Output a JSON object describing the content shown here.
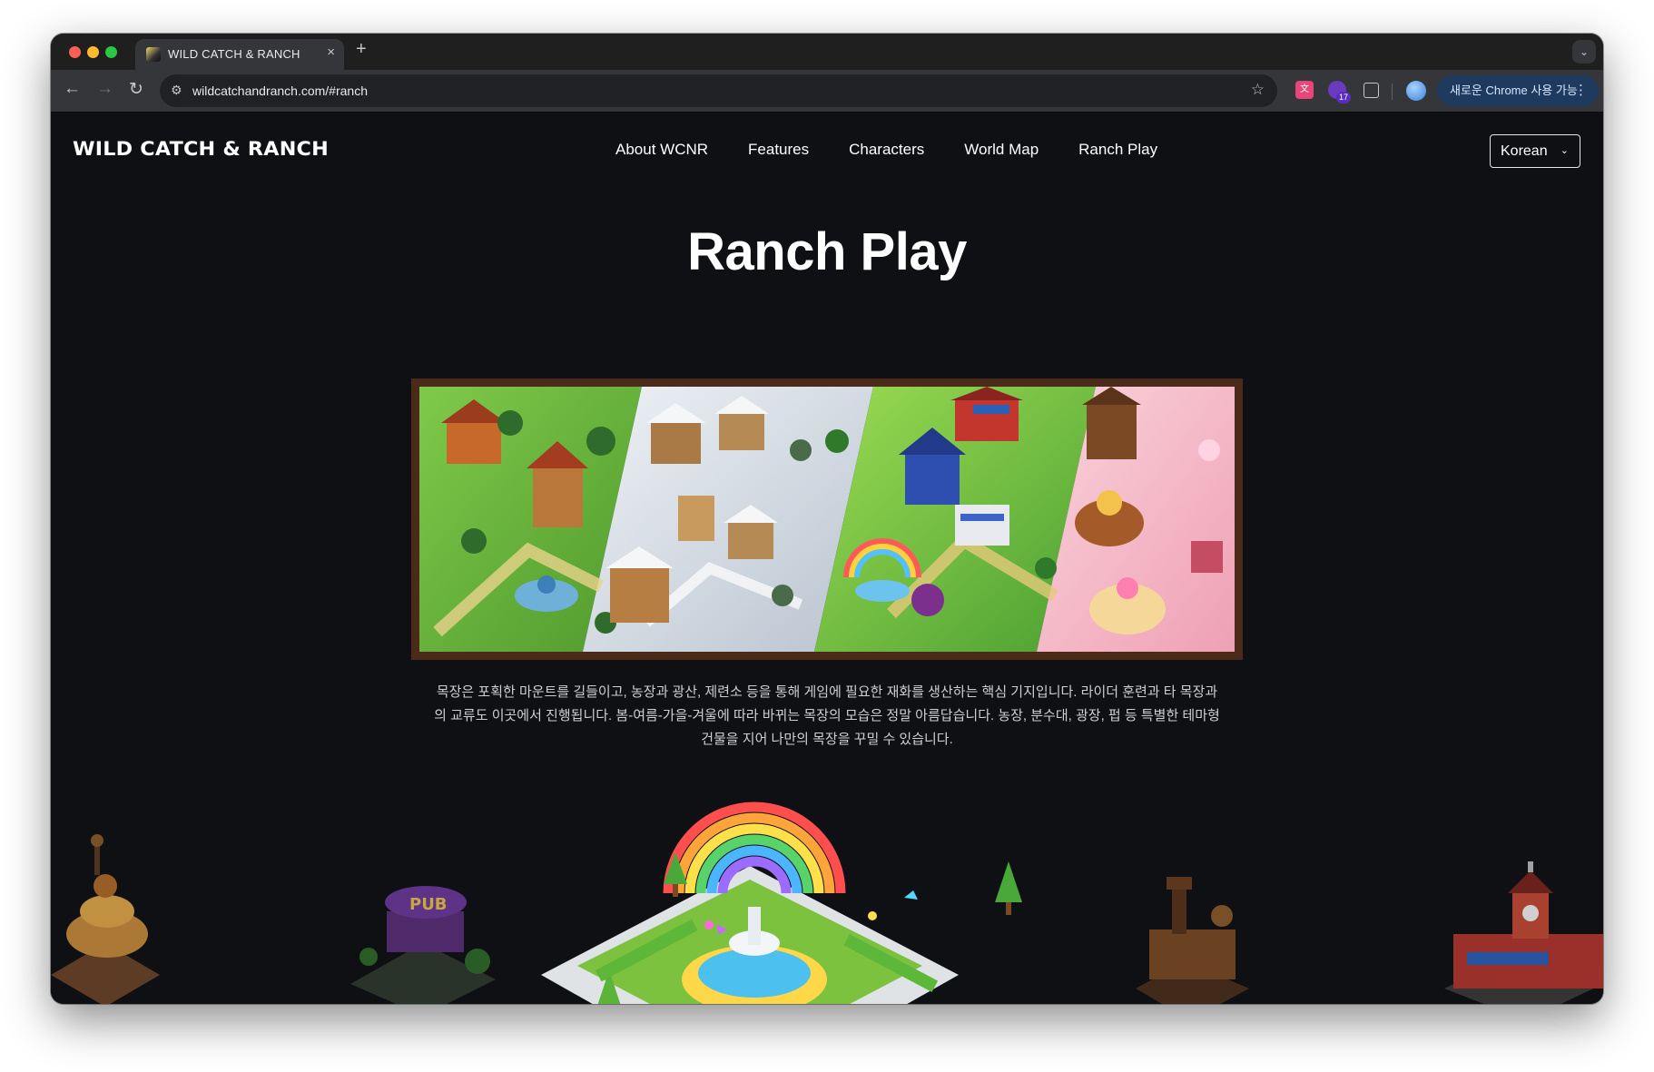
{
  "browser": {
    "tab_title": "WILD CATCH & RANCH",
    "tab_close": "×",
    "new_tab": "+",
    "tab_menu": "⌄",
    "back": "←",
    "forward": "→",
    "reload": "↻",
    "url": "wildcatchandranch.com/#ranch",
    "bookmark": "☆",
    "update_label": "새로운 Chrome 사용 가능",
    "update_menu": "⋮",
    "extension_badge": "17"
  },
  "site": {
    "logo": "WILD CATCH & RANCH",
    "nav": [
      "About WCNR",
      "Features",
      "Characters",
      "World Map",
      "Ranch Play"
    ],
    "language": "Korean",
    "language_chevron": "⌄"
  },
  "section": {
    "title": "Ranch Play",
    "description": "목장은 포획한 마운트를 길들이고, 농장과 광산, 제련소 등을 통해 게임에 필요한 재화를 생산하는 핵심 기지입니다. 라이더 훈련과 타 목장과의 교류도 이곳에서 진행됩니다. 봄-여름-가을-겨울에 따라 바뀌는 목장의 모습은 정말 아름답습니다. 농장, 분수대, 광장, 펍 등 특별한 테마형 건물을 지어 나만의 목장을 꾸밀 수 있습니다."
  },
  "colors": {
    "page_bg": "#0f1014",
    "frame": "#4b2a1a",
    "spring": "#6cbf3a",
    "winter": "#dfe6ee",
    "summer": "#7fcf3e",
    "candy": "#f7b7c6"
  },
  "icons": [
    "translate-extension-icon",
    "calendar-extension-icon",
    "puzzle-icon",
    "profile-avatar",
    "bookmark-star-icon",
    "site-settings-icon"
  ]
}
